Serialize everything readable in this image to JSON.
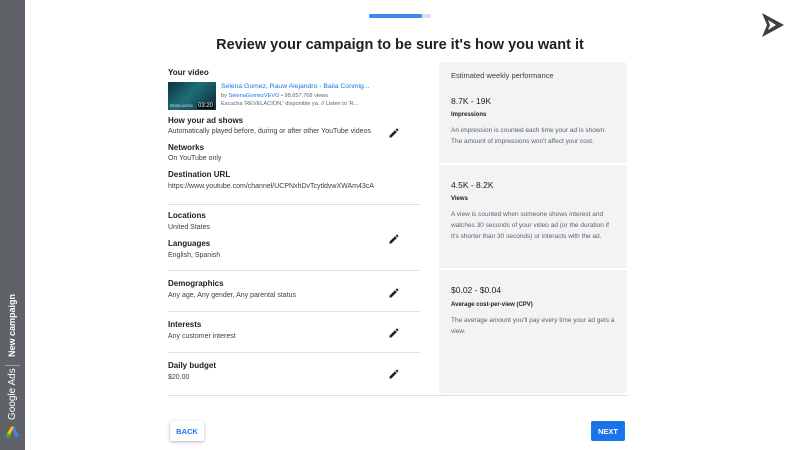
{
  "rail": {
    "product": "Google Ads",
    "context": "New campaign"
  },
  "progress": {
    "fraction": 0.85
  },
  "page_title": "Review your campaign to be sure it's how you want it",
  "summary": {
    "video": {
      "label": "Your video",
      "duration": "03:20",
      "thumb_brand": "REVELACIÓN",
      "title": "Selena Gomez, Rauw Alejandro - Baila Conmig...",
      "channel_prefix": "by ",
      "channel": "SelenaGomezVEVO",
      "views": " • 98,657,768 views",
      "description": "Escucha 'REVELACIÓN,' disponible ya. // Listen to 'R..."
    },
    "ad_shows": {
      "label": "How your ad shows",
      "value": "Automatically played before, during or after other YouTube videos"
    },
    "networks": {
      "label": "Networks",
      "value": "On YouTube only"
    },
    "destination": {
      "label": "Destination URL",
      "value": "https://www.youtube.com/channel/UCPNxhDvTcytldvwXWAm43cA"
    },
    "locations": {
      "label": "Locations",
      "value": "United States"
    },
    "languages": {
      "label": "Languages",
      "value": "English, Spanish"
    },
    "demographics": {
      "label": "Demographics",
      "value": "Any age, Any gender, Any parental status"
    },
    "interests": {
      "label": "Interests",
      "value": "Any customer interest"
    },
    "budget": {
      "label": "Daily budget",
      "value": "$20.00"
    }
  },
  "performance": {
    "heading": "Estimated weekly performance",
    "metrics": [
      {
        "range": "8.7K - 19K",
        "name": "Impressions",
        "description": "An impression is counted each time your ad is shown. The amount of impressions won't affect your cost."
      },
      {
        "range": "4.5K - 8.2K",
        "name": "Views",
        "description": "A view is counted when someone shows interest and watches 30 seconds of your video ad (or the duration if it's shorter than 30 seconds) or interacts with the ad."
      },
      {
        "range": "$0.02 - $0.04",
        "name": "Average cost-per-view (CPV)",
        "description": "The average amount you'll pay every time your ad gets a view."
      }
    ]
  },
  "buttons": {
    "back": "BACK",
    "next": "NEXT"
  },
  "colors": {
    "accent": "#1a73e8",
    "rail": "#5f6368",
    "panel": "#f1f3f4",
    "progress": "#4285f4"
  },
  "icons": {
    "edit": "pencil-icon",
    "brand": "google-ads-logo-icon",
    "corner": "play-triangle-logo-icon"
  }
}
